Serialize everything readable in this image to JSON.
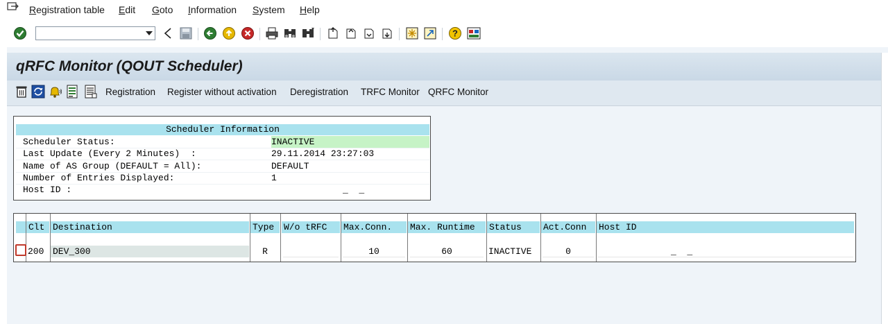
{
  "menu": {
    "items": [
      "Registration table",
      "Edit",
      "Goto",
      "Information",
      "System",
      "Help"
    ]
  },
  "toolbar": {
    "command_field_value": ""
  },
  "title": "qRFC Monitor (QOUT Scheduler)",
  "app_toolbar": {
    "buttons": [
      "Registration",
      "Register without activation",
      "Deregistration",
      "TRFC Monitor",
      "QRFC Monitor"
    ]
  },
  "scheduler": {
    "heading": "Scheduler Information",
    "rows": [
      {
        "label": "Scheduler Status:",
        "value": "INACTIVE"
      },
      {
        "label": "Last Update (Every 2 Minutes)  :",
        "value": "29.11.2014 23:27:03"
      },
      {
        "label": "Name of AS Group (DEFAULT = All):",
        "value": "DEFAULT"
      },
      {
        "label": "Number of Entries Displayed:",
        "value": "1"
      },
      {
        "label": "Host ID :",
        "value": "_  _"
      }
    ]
  },
  "table": {
    "headers": [
      "Clt",
      "Destination",
      "Type",
      "W/o tRFC",
      "Max.Conn.",
      "Max. Runtime",
      "Status",
      "Act.Conn",
      "Host ID"
    ],
    "rows": [
      {
        "clt": "200",
        "destination": "DEV_300",
        "type": "R",
        "wo_trfc": "",
        "max_conn": "10",
        "max_runtime": "60",
        "status": "INACTIVE",
        "act_conn": "0",
        "host_id": "_  _"
      }
    ]
  },
  "colors": {
    "header_bg": "#a9e2ee",
    "status_bg": "#c6f3c6",
    "workspace_bg": "#eff4f9"
  }
}
